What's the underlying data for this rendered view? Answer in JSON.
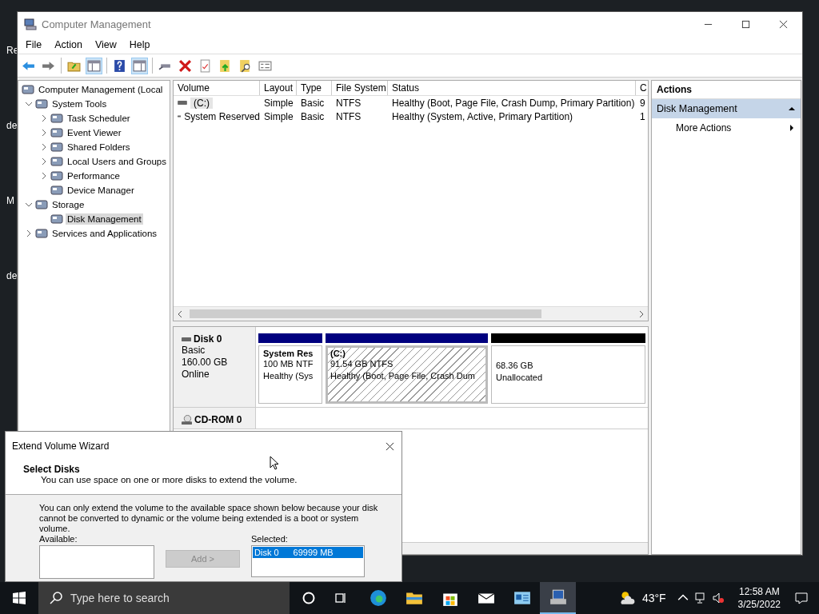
{
  "desktop_labels": [
    "Re",
    "de",
    "M",
    "de"
  ],
  "window": {
    "title": "Computer Management"
  },
  "menu": [
    "File",
    "Action",
    "View",
    "Help"
  ],
  "tree": [
    {
      "label": "Computer Management (Local",
      "selected": false,
      "children": [
        {
          "label": "System Tools",
          "expanded": true,
          "selected": false,
          "children": [
            {
              "label": "Task Scheduler",
              "expanded": false,
              "selected": false
            },
            {
              "label": "Event Viewer",
              "expanded": false,
              "selected": false
            },
            {
              "label": "Shared Folders",
              "expanded": false,
              "selected": false
            },
            {
              "label": "Local Users and Groups",
              "expanded": false,
              "selected": false
            },
            {
              "label": "Performance",
              "expanded": false,
              "selected": false
            },
            {
              "label": "Device Manager",
              "selected": false
            }
          ]
        },
        {
          "label": "Storage",
          "expanded": true,
          "selected": false,
          "children": [
            {
              "label": "Disk Management",
              "selected": true
            }
          ]
        },
        {
          "label": "Services and Applications",
          "expanded": false,
          "selected": false
        }
      ]
    }
  ],
  "volumes": {
    "columns": [
      "Volume",
      "Layout",
      "Type",
      "File System",
      "Status",
      "C"
    ],
    "rows": [
      {
        "selected": true,
        "cells": [
          "(C:)",
          "Simple",
          "Basic",
          "NTFS",
          "Healthy (Boot, Page File, Crash Dump, Primary Partition)",
          "9"
        ]
      },
      {
        "selected": false,
        "cells": [
          "System Reserved",
          "Simple",
          "Basic",
          "NTFS",
          "Healthy (System, Active, Primary Partition)",
          "1"
        ]
      }
    ]
  },
  "disks": [
    {
      "kind": "disk",
      "name": "Disk 0",
      "details": [
        "Basic",
        "160.00 GB",
        "Online"
      ],
      "partitions": [
        {
          "color": "#00007f",
          "selected": false,
          "name": "System Res",
          "size": "100 MB NTF",
          "status": "Healthy (Sys"
        },
        {
          "color": "#00007f",
          "selected": true,
          "name": "(C:)",
          "size": "91.54 GB NTFS",
          "status": "Healthy (Boot, Page File, Crash Dum"
        },
        {
          "color": "#000000",
          "selected": false,
          "size": "68.36 GB",
          "status": "Unallocated"
        }
      ]
    },
    {
      "kind": "cdrom",
      "name": "CD-ROM 0"
    }
  ],
  "actions": {
    "title": "Actions",
    "sections": [
      {
        "label": "Disk Management",
        "expanded": true,
        "items": [
          "More Actions"
        ]
      }
    ]
  },
  "dialog": {
    "title": "Extend Volume Wizard",
    "heading": "Select Disks",
    "subheading": "You can use space on one or more disks to extend the volume.",
    "message": "You can only extend the volume to the available space shown below because your disk cannot be converted to dynamic or the volume being extended is a boot or system volume.",
    "available_label": "Available:",
    "add_button": {
      "label": "Add >",
      "disabled": true
    },
    "selected_label": "Selected:",
    "selected_items": [
      {
        "disk": "Disk 0",
        "size": "69999 MB",
        "selected": true
      }
    ]
  },
  "taskbar": {
    "search_placeholder": "Type here to search",
    "apps": [
      {
        "kind": "edge",
        "active": false
      },
      {
        "kind": "explorer",
        "active": false
      },
      {
        "kind": "store",
        "active": false
      },
      {
        "kind": "mail",
        "active": false
      },
      {
        "kind": "console",
        "active": false
      },
      {
        "kind": "management",
        "active": true
      }
    ],
    "weather": "43°F",
    "time": "12:58 AM",
    "date": "3/25/2022"
  }
}
